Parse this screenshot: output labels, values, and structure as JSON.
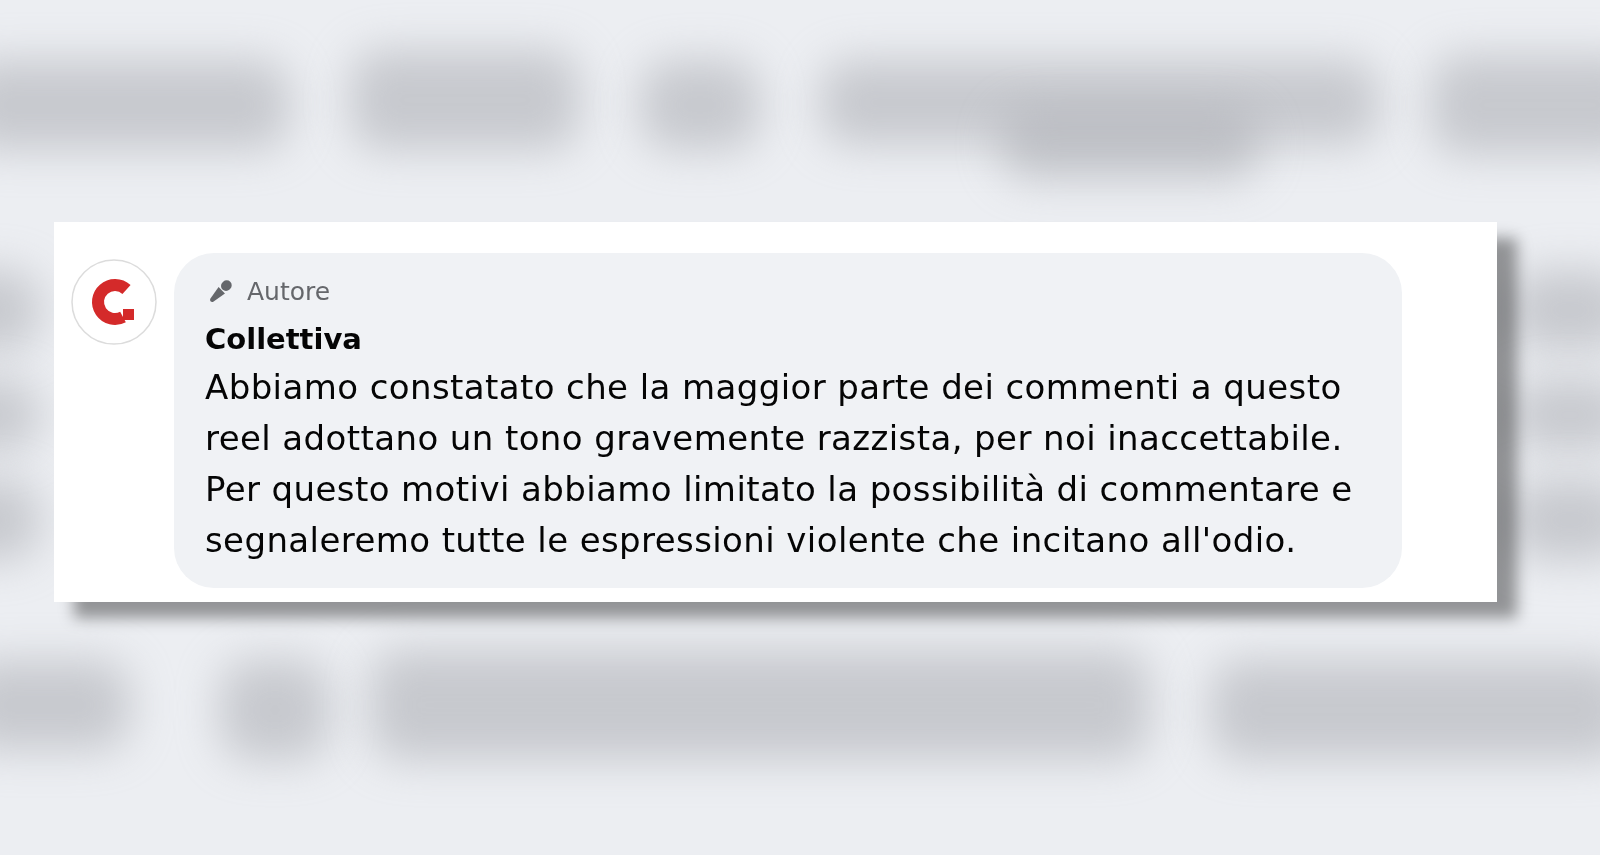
{
  "comment": {
    "badge": {
      "label": "Autore"
    },
    "author": "Collettiva",
    "lines": [
      "Abbiamo constatato che la maggior parte dei commenti a questo",
      "reel adottano un tono gravemente razzista, per noi inaccettabile.",
      "Per questo motivi abbiamo limitato la possibilità di commentare e",
      "segnaleremo tutte le espressioni violente che incitano all'odio."
    ]
  }
}
